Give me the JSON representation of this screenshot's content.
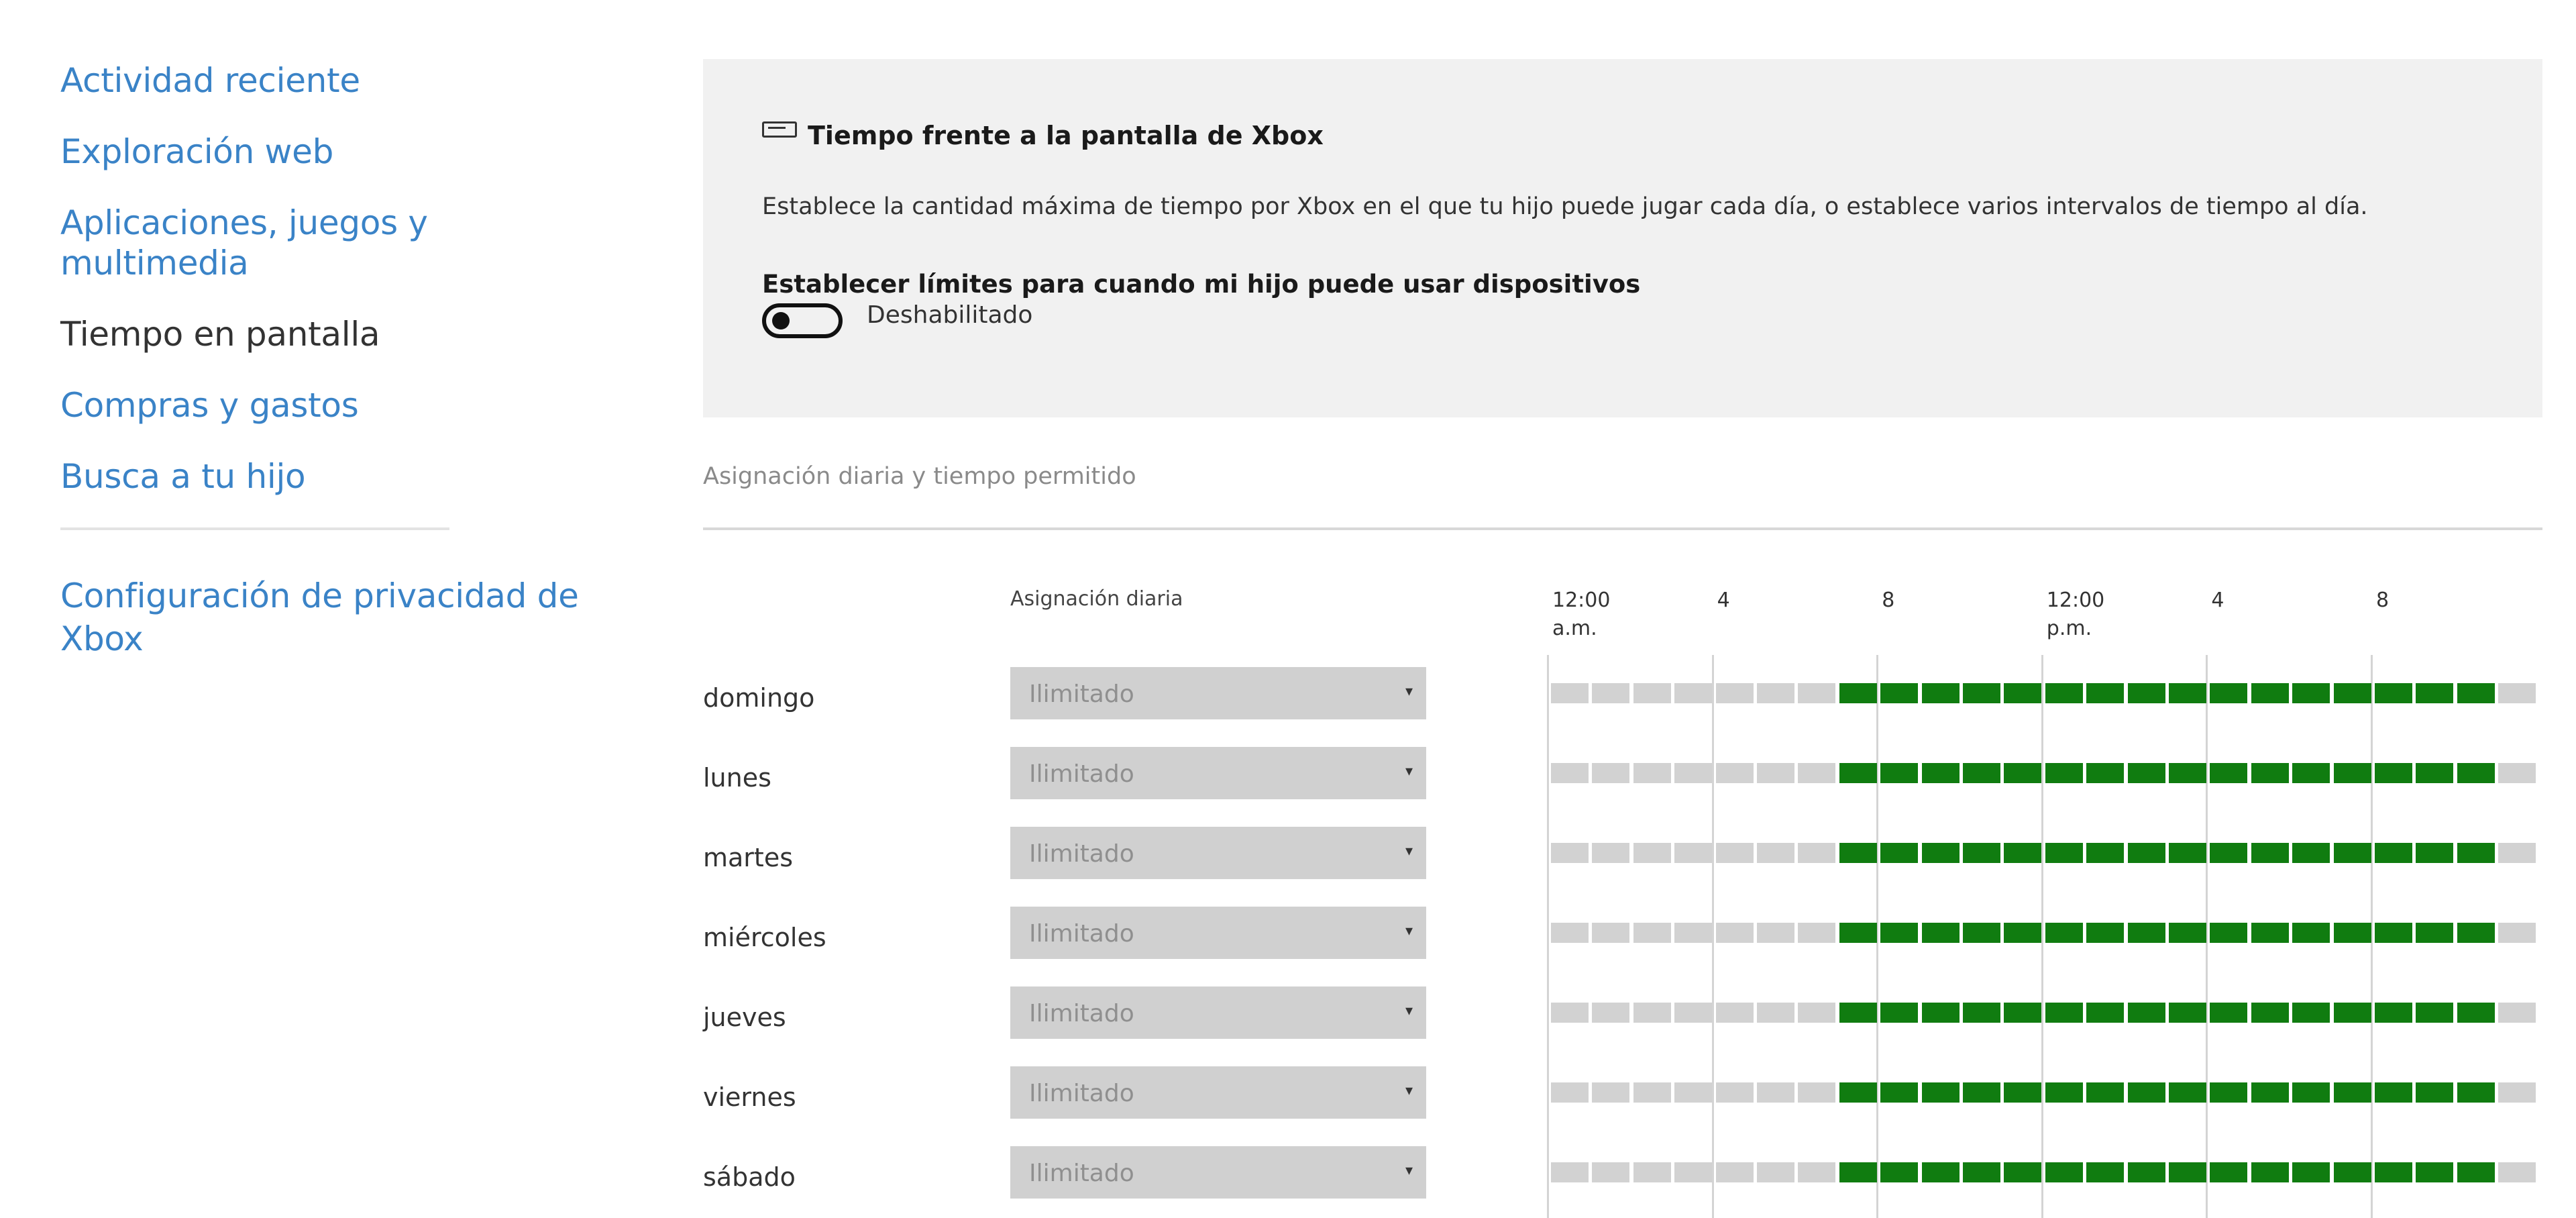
{
  "sidebar": {
    "items": [
      {
        "label": "Actividad reciente",
        "active": false
      },
      {
        "label": "Exploración web",
        "active": false
      },
      {
        "label": "Aplicaciones, juegos y multimedia",
        "active": false
      },
      {
        "label": "Tiempo en pantalla",
        "active": true
      },
      {
        "label": "Compras y gastos",
        "active": false
      },
      {
        "label": "Busca a tu hijo",
        "active": false
      }
    ],
    "privacy_line1": "Configuración de privacidad de",
    "privacy_line2": "Xbox"
  },
  "panel": {
    "icon": "xbox-console-icon",
    "title": "Tiempo frente a la pantalla de Xbox",
    "description": "Establece la cantidad máxima de tiempo por Xbox en el que tu hijo puede jugar cada día, o establece varios intervalos de tiempo al día.",
    "limits_heading": "Establecer límites para cuando mi hijo puede usar dispositivos",
    "toggle_state": "Deshabilitado"
  },
  "schedule": {
    "section_title": "Asignación diaria y tiempo permitido",
    "allowance_header": "Asignación diaria",
    "hour_labels": [
      {
        "line1": "12:00",
        "line2": "a.m."
      },
      {
        "line1": "4",
        "line2": ""
      },
      {
        "line1": "8",
        "line2": ""
      },
      {
        "line1": "12:00",
        "line2": "p.m."
      },
      {
        "line1": "4",
        "line2": ""
      },
      {
        "line1": "8",
        "line2": ""
      }
    ],
    "slots_per_day": 24,
    "allowed_from_slot": 7,
    "allowed_to_slot": 22,
    "colors": {
      "allowed": "#107c10",
      "blocked": "#d2d2d2"
    },
    "days": [
      {
        "name": "domingo",
        "allowance": "Ilimitado"
      },
      {
        "name": "lunes",
        "allowance": "Ilimitado"
      },
      {
        "name": "martes",
        "allowance": "Ilimitado"
      },
      {
        "name": "miércoles",
        "allowance": "Ilimitado"
      },
      {
        "name": "jueves",
        "allowance": "Ilimitado"
      },
      {
        "name": "viernes",
        "allowance": "Ilimitado"
      },
      {
        "name": "sábado",
        "allowance": "Ilimitado"
      }
    ]
  }
}
